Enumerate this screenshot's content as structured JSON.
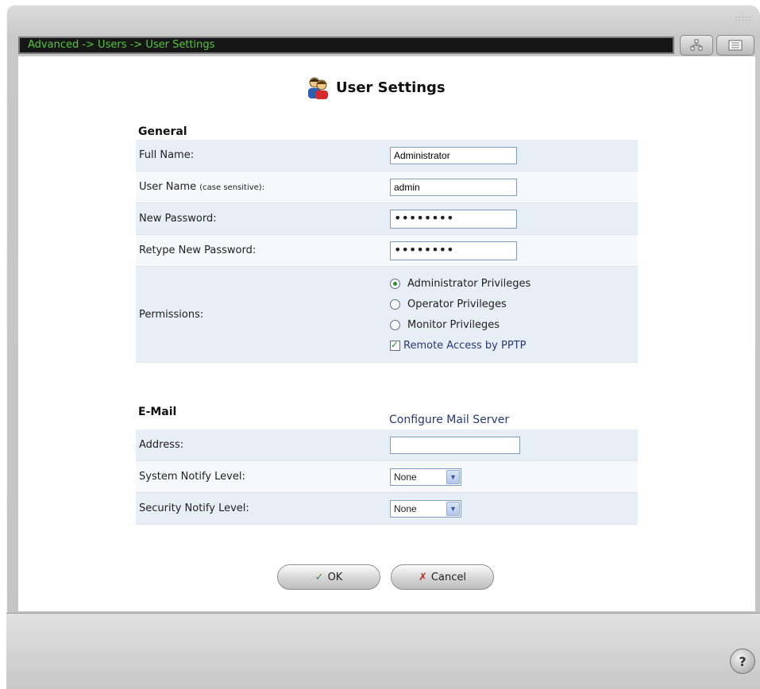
{
  "breadcrumb": "Advanced -> Users -> User Settings",
  "page_title": "User Settings",
  "general": {
    "heading": "General",
    "full_name": {
      "label": "Full Name:",
      "value": "Administrator"
    },
    "user_name": {
      "label": "User Name",
      "note": "(case sensitive):",
      "value": "admin"
    },
    "new_password": {
      "label": "New Password:",
      "masked": "••••••••"
    },
    "retype_password": {
      "label": "Retype New Password:",
      "masked": "••••••••"
    },
    "permissions": {
      "label": "Permissions:",
      "options": [
        "Administrator Privileges",
        "Operator Privileges",
        "Monitor Privileges"
      ],
      "selected": "Administrator Privileges",
      "remote_access": {
        "label": "Remote Access by PPTP",
        "checked": true
      }
    }
  },
  "email": {
    "heading": "E-Mail",
    "configure_link": "Configure Mail Server",
    "address": {
      "label": "Address:",
      "value": ""
    },
    "system_notify": {
      "label": "System Notify Level:",
      "value": "None"
    },
    "security_notify": {
      "label": "Security Notify Level:",
      "value": "None"
    }
  },
  "buttons": {
    "ok": "OK",
    "cancel": "Cancel"
  },
  "icons": [
    "users-icon",
    "network-map-icon",
    "list-view-icon",
    "help-icon",
    "check-icon",
    "x-icon",
    "chevron-down-icon"
  ],
  "colors": {
    "breadcrumb_text": "#55c83a",
    "row_odd": "#e7eef6",
    "link": "#283a6e"
  }
}
